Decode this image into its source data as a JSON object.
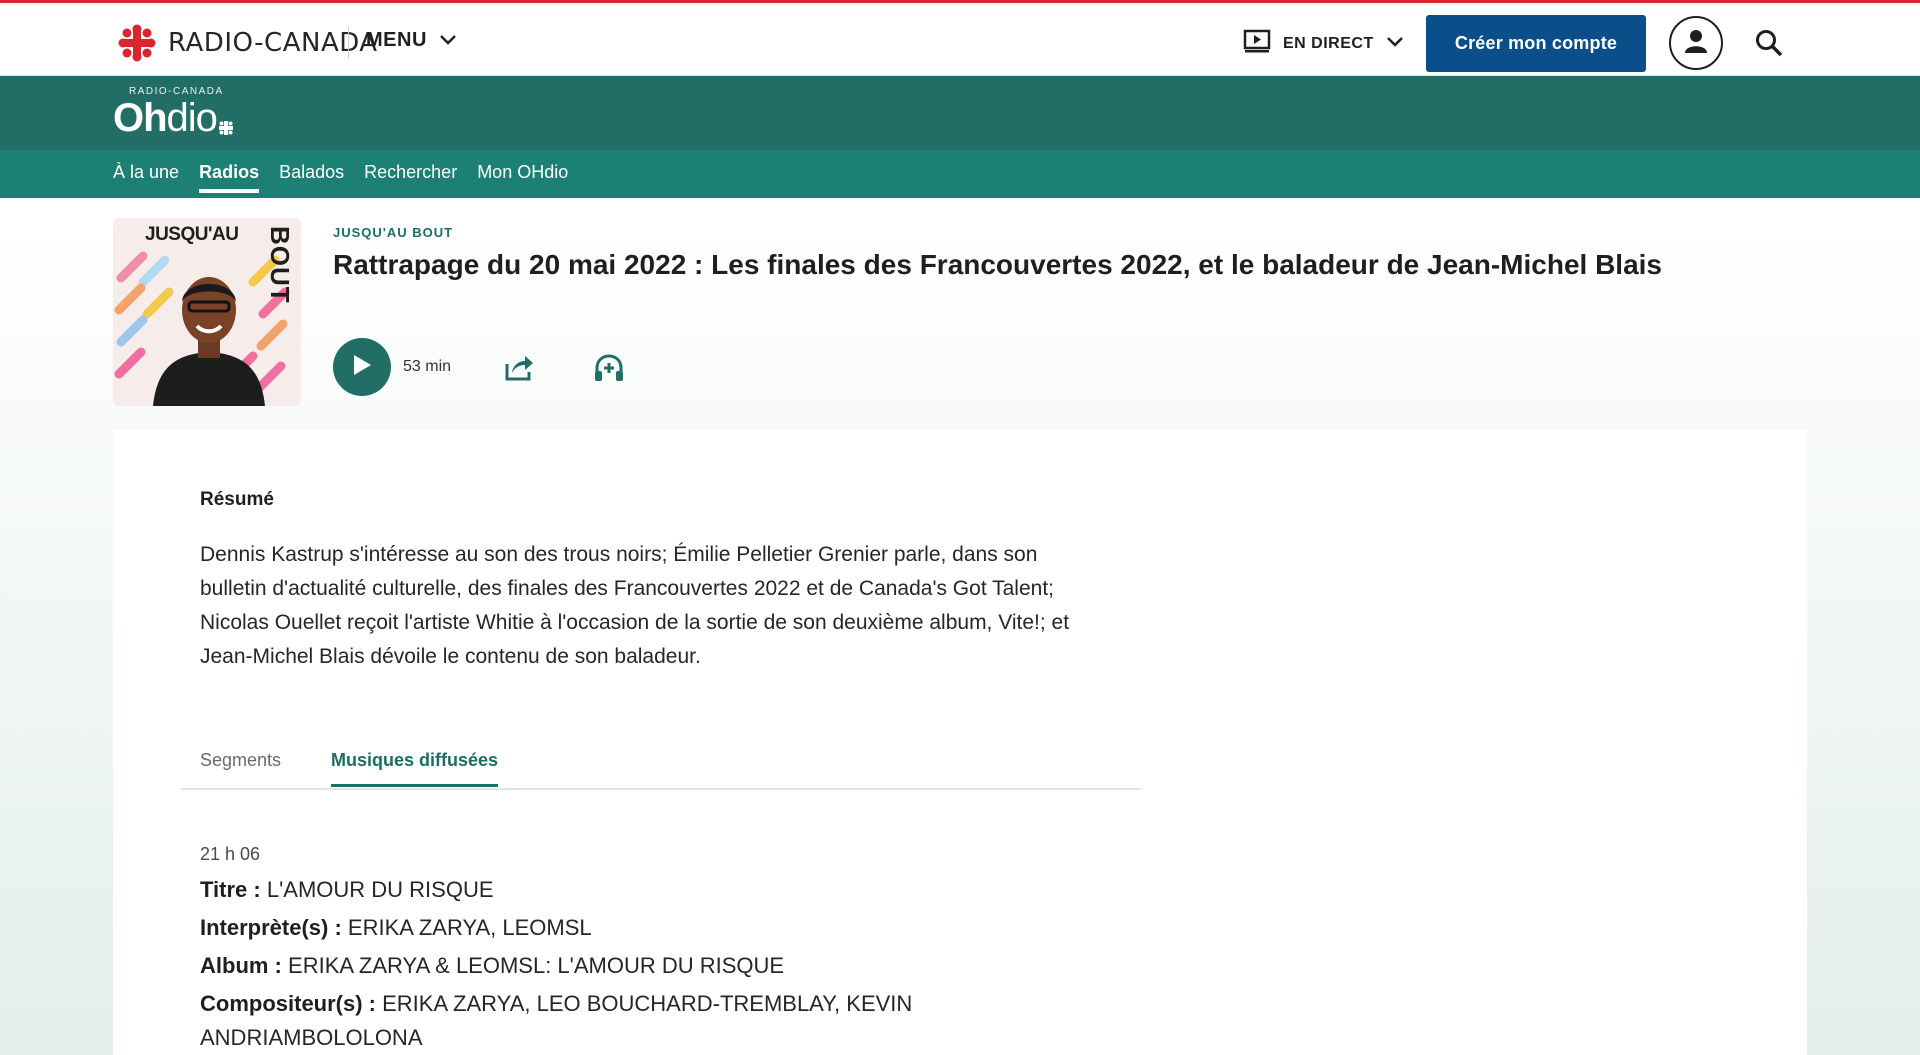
{
  "header": {
    "brand": "RADIO-CANADA",
    "menu_label": "MENU",
    "live_label": "EN DIRECT",
    "cta_label": "Créer mon compte",
    "icons": {
      "brand": "cbc-gem-icon",
      "menu_chevron": "chevron-down-icon",
      "live": "tv-play-icon",
      "live_chevron": "chevron-down-icon",
      "account": "user-icon",
      "search": "search-icon"
    },
    "colors": {
      "brand_red": "#d9262c",
      "cta_blue": "#0b4f8a"
    }
  },
  "ohdio": {
    "small_label": "RADIO-CANADA",
    "logo_bold": "Oh",
    "logo_light": "dio",
    "colors": {
      "band": "#226e67",
      "nav": "#1c8075"
    }
  },
  "nav": {
    "items": [
      {
        "label": "À la une",
        "active": false
      },
      {
        "label": "Radios",
        "active": true
      },
      {
        "label": "Balados",
        "active": false
      },
      {
        "label": "Rechercher",
        "active": false
      },
      {
        "label": "Mon OHdio",
        "active": false
      }
    ]
  },
  "episode": {
    "show_label": "JUSQU'AU BOUT",
    "cover_line1": "JUSQU'AU",
    "cover_line2": "BOUT",
    "title": "Rattrapage du 20 mai 2022 : Les finales des Francouvertes 2022, et le baladeur de Jean-Michel Blais",
    "duration": "53 min",
    "icons": {
      "play": "play-icon",
      "share": "share-icon",
      "subscribe": "headphones-add-icon"
    }
  },
  "summary": {
    "heading": "Résumé",
    "text": "Dennis Kastrup s'intéresse au son des trous noirs; Émilie Pelletier Grenier parle, dans son bulletin d'actualité culturelle, des finales des Francouvertes 2022 et de Canada's Got Talent; Nicolas Ouellet reçoit l'artiste Whitie à l'occasion de la sortie de son deuxième album, Vite!; et Jean-Michel Blais dévoile le contenu de son baladeur."
  },
  "tabs": [
    {
      "label": "Segments",
      "active": false
    },
    {
      "label": "Musiques diffusées",
      "active": true
    }
  ],
  "track": {
    "time": "21 h 06",
    "title_label": "Titre :",
    "title_value": "L'AMOUR DU RISQUE",
    "artist_label": "Interprète(s) :",
    "artist_value": "ERIKA ZARYA, LEOMSL",
    "album_label": "Album :",
    "album_value": "ERIKA ZARYA & LEOMSL: L'AMOUR DU RISQUE",
    "composer_label": "Compositeur(s) :",
    "composer_value": "ERIKA ZARYA, LEO BOUCHARD-TREMBLAY, KEVIN ANDRIAMBOLOLONA"
  }
}
